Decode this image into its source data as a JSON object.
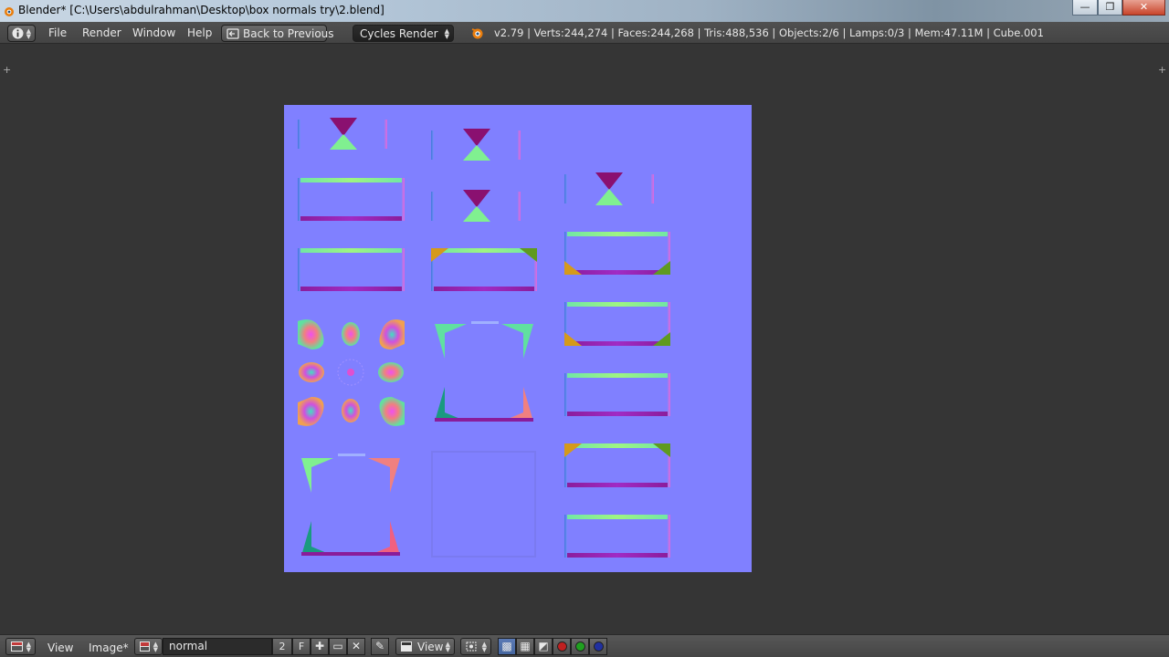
{
  "window": {
    "title": "Blender* [C:\\Users\\abdulrahman\\Desktop\\box normals try\\2.blend]",
    "controls": {
      "minimize": "—",
      "maximize": "❐",
      "close": "✕"
    }
  },
  "menubar": {
    "info_icon": "i",
    "items": [
      "File",
      "Render",
      "Window",
      "Help"
    ],
    "back_button": "Back to Previous",
    "render_engine": "Cycles Render",
    "stats": "v2.79 | Verts:244,274 | Faces:244,268 | Tris:488,536 | Objects:2/6 | Lamps:0/3 | Mem:47.11M | Cube.001"
  },
  "footer": {
    "menus": [
      "View",
      "Image*"
    ],
    "image_name": "normal",
    "user_count": "2",
    "fake_user": "F",
    "view_mode": "View"
  },
  "colors": {
    "flat_normal": "#8080ff",
    "panel_bg": "#353535",
    "header_bg": "#4a4a4a"
  }
}
